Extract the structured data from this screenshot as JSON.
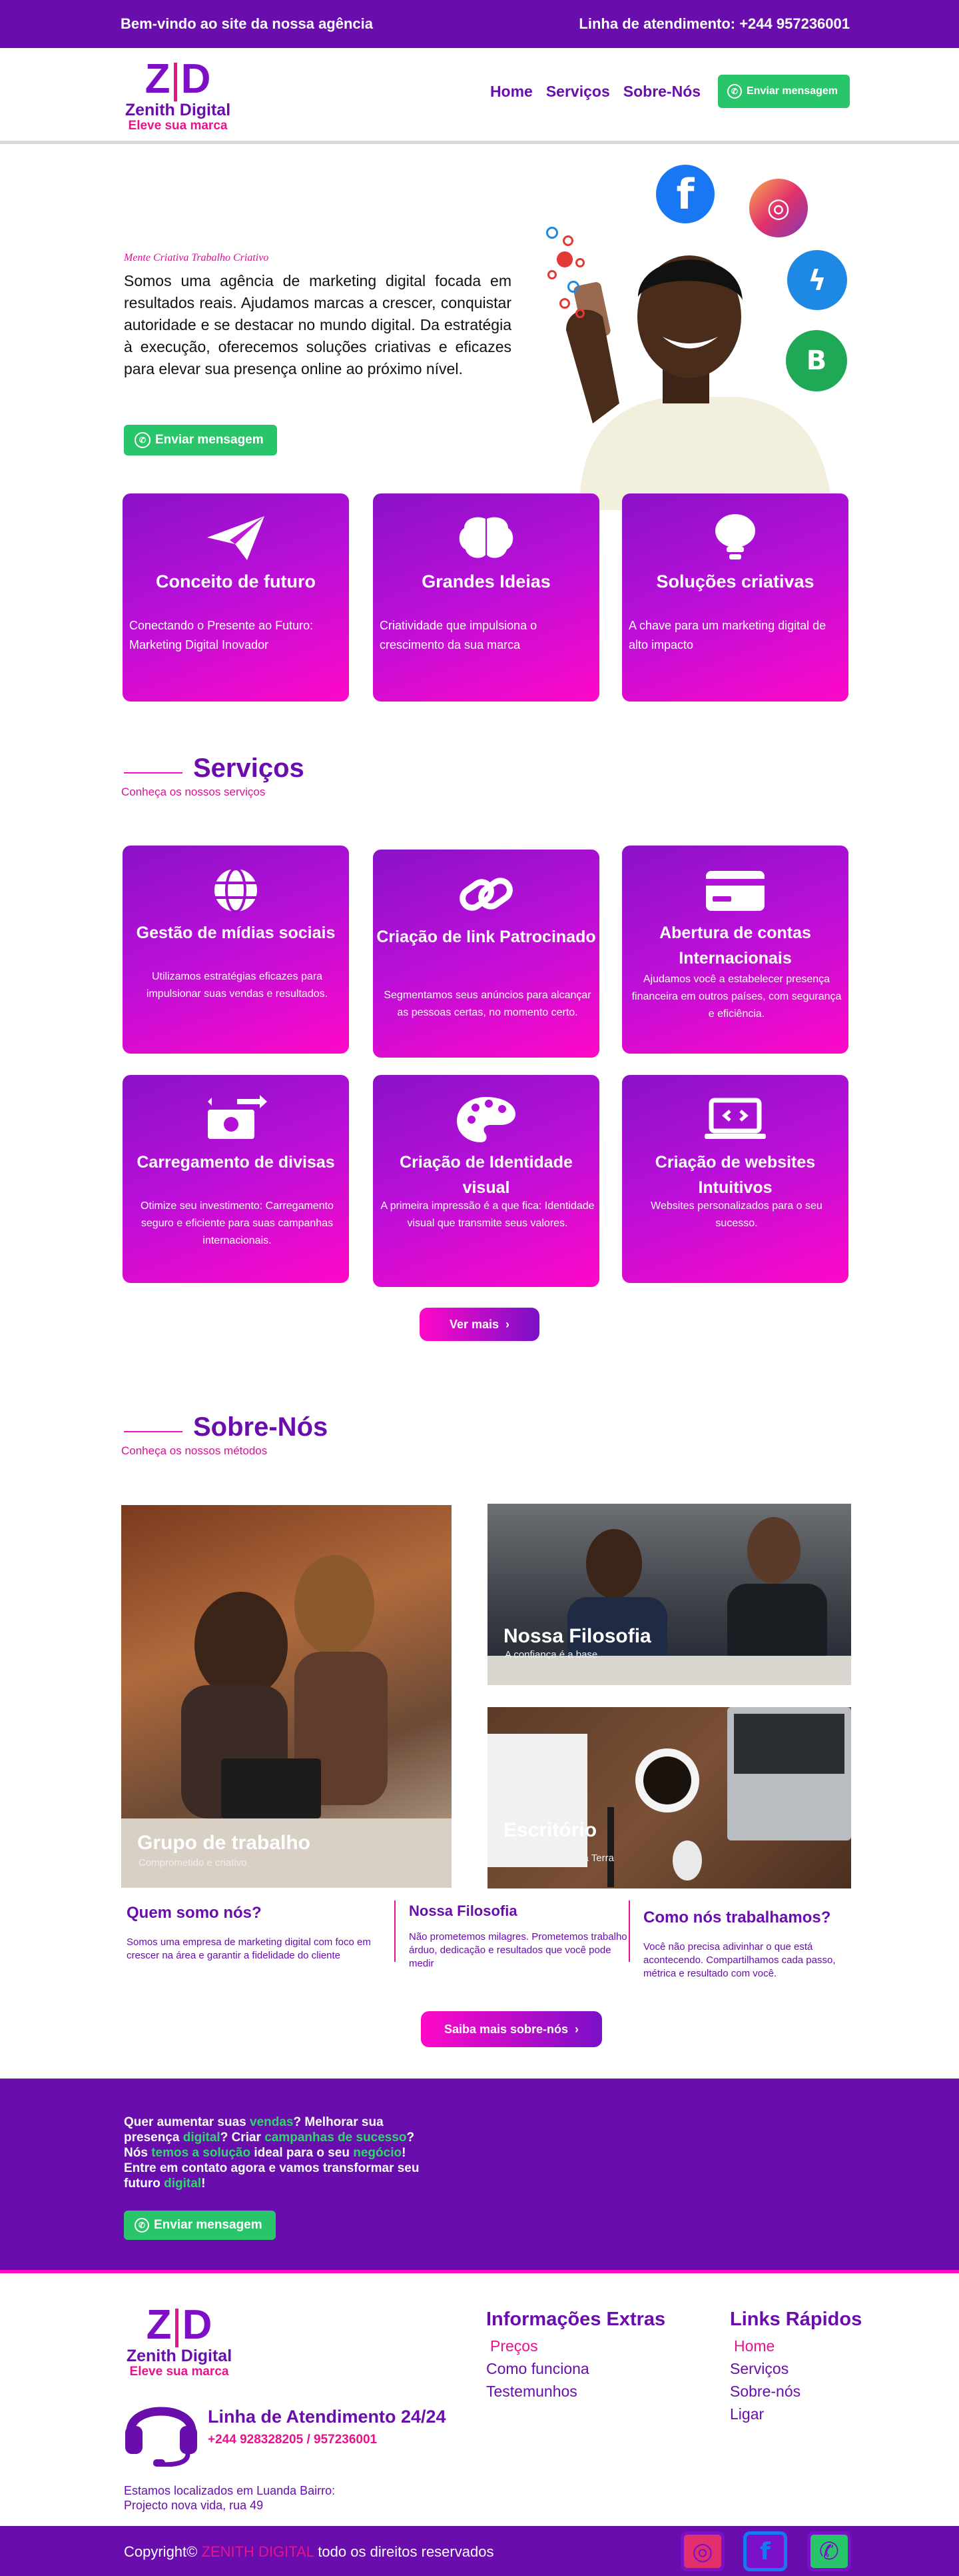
{
  "topbar": {
    "welcome": "Bem-vindo ao site da nossa agência",
    "hotline": "Linha de atendimento: +244 957236001"
  },
  "brand": {
    "mark_left": "Z",
    "mark_bar": "|",
    "mark_right": "D",
    "name": "Zenith Digital",
    "tagline": "Eleve sua marca"
  },
  "nav": {
    "items": [
      "Home",
      "Serviços",
      "Sobre-Nós"
    ],
    "cta": "Enviar mensagem"
  },
  "hero": {
    "kicker": "Mente Criativa Trabalho Criativo",
    "text": "Somos uma agência de marketing digital focada em resultados reais. Ajudamos marcas a crescer, conquistar autoridade e se destacar no mundo digital. Da estratégia à execução, oferecemos soluções criativas e eficazes para elevar sua presença online ao próximo nível.",
    "cta": "Enviar mensagem"
  },
  "features": [
    {
      "title": "Conceito de futuro",
      "text": "Conectando o Presente ao Futuro: Marketing Digital Inovador",
      "icon": "paper-plane-icon"
    },
    {
      "title": "Grandes Ideias",
      "text": "Criatividade que impulsiona o crescimento da sua marca",
      "icon": "brain-icon"
    },
    {
      "title": "Soluções criativas",
      "text": "A chave para um marketing digital de alto impacto",
      "icon": "lightbulb-icon"
    }
  ],
  "services_section": {
    "title": "Serviços",
    "subtitle": "Conheça os nossos serviços",
    "more": "Ver mais"
  },
  "services": [
    {
      "title": "Gestão de mídias sociais",
      "text": "Utilizamos estratégias eficazes para impulsionar suas vendas e resultados.",
      "icon": "globe-icon"
    },
    {
      "title": "Criação de link Patrocinado",
      "text": "Segmentamos seus anúncios para alcançar as pessoas certas, no momento certo.",
      "icon": "link-icon"
    },
    {
      "title": "Abertura de contas Internacionais",
      "text": "Ajudamos você a estabelecer presença financeira em outros países, com segurança e eficiência.",
      "icon": "credit-card-icon"
    },
    {
      "title": "Carregamento de divisas",
      "text": "Otimize seu investimento: Carregamento seguro e eficiente para suas campanhas internacionais.",
      "icon": "money-exchange-icon"
    },
    {
      "title": "Criação de Identidade visual",
      "text": "A primeira impressão é a que fica: Identidade visual que transmite seus valores.",
      "icon": "palette-icon"
    },
    {
      "title": "Criação de websites Intuitivos",
      "text": "Websites personalizados para o seu sucesso.",
      "icon": "laptop-code-icon"
    }
  ],
  "about_section": {
    "title": "Sobre-Nós",
    "subtitle": "Conheça os nossos métodos",
    "more": "Saiba mais sobre-nós"
  },
  "gallery": [
    {
      "title": "Grupo de trabalho",
      "sub": "Comprometido e criativo"
    },
    {
      "title": "Nossa Filosofia",
      "sub": "A confiança é a base"
    },
    {
      "title": "Escritório",
      "sub": "Em algum lugar da Terra"
    }
  ],
  "about_cols": [
    {
      "title": "Quem somo nós?",
      "text": "Somos uma empresa de marketing digital com foco em crescer na área e garantir a fidelidade do cliente"
    },
    {
      "title": "Nossa Filosofia",
      "text": "Não prometemos milagres. Prometemos trabalho árduo, dedicação e resultados que você pode medir"
    },
    {
      "title": "Como nós trabalhamos?",
      "text": "Você não precisa adivinhar o que está acontecendo. Compartilhamos cada passo, métrica e resultado com você."
    }
  ],
  "cta": {
    "p1": "Quer aumentar suas ",
    "g1": "vendas",
    "p2": "? Melhorar sua presença ",
    "g2": "digital",
    "p3": "? Criar ",
    "g3": "campanhas de sucesso",
    "p4": "? Nós ",
    "g4": "temos a solução",
    "p5": " ideal para o seu ",
    "g5": "negócio",
    "p6": "! Entre em contato agora e vamos transformar seu futuro ",
    "g6": "digital",
    "p7": "!",
    "button": "Enviar mensagem"
  },
  "footer": {
    "support_title": "Linha de Atendimento 24/24",
    "support_phones": "+244 928328205 / 957236001",
    "address_1": "Estamos localizados em Luanda Bairro:",
    "address_2": "Projecto nova vida, rua 49",
    "extras_title": "Informações Extras",
    "extras": [
      "Preços",
      "Como funciona",
      "Testemunhos"
    ],
    "links_title": "Links Rápidos",
    "links": [
      "Home",
      "Serviços",
      "Sobre-nós",
      "Ligar"
    ]
  },
  "bottom": {
    "copy_prefix": "Copyright©",
    "copy_brand": "ZENITH DIGITAL",
    "copy_suffix": "todo os direitos reservados"
  },
  "colors": {
    "primary": "#6a0dad",
    "accent": "#ff08c8",
    "whatsapp": "#29c56a"
  }
}
